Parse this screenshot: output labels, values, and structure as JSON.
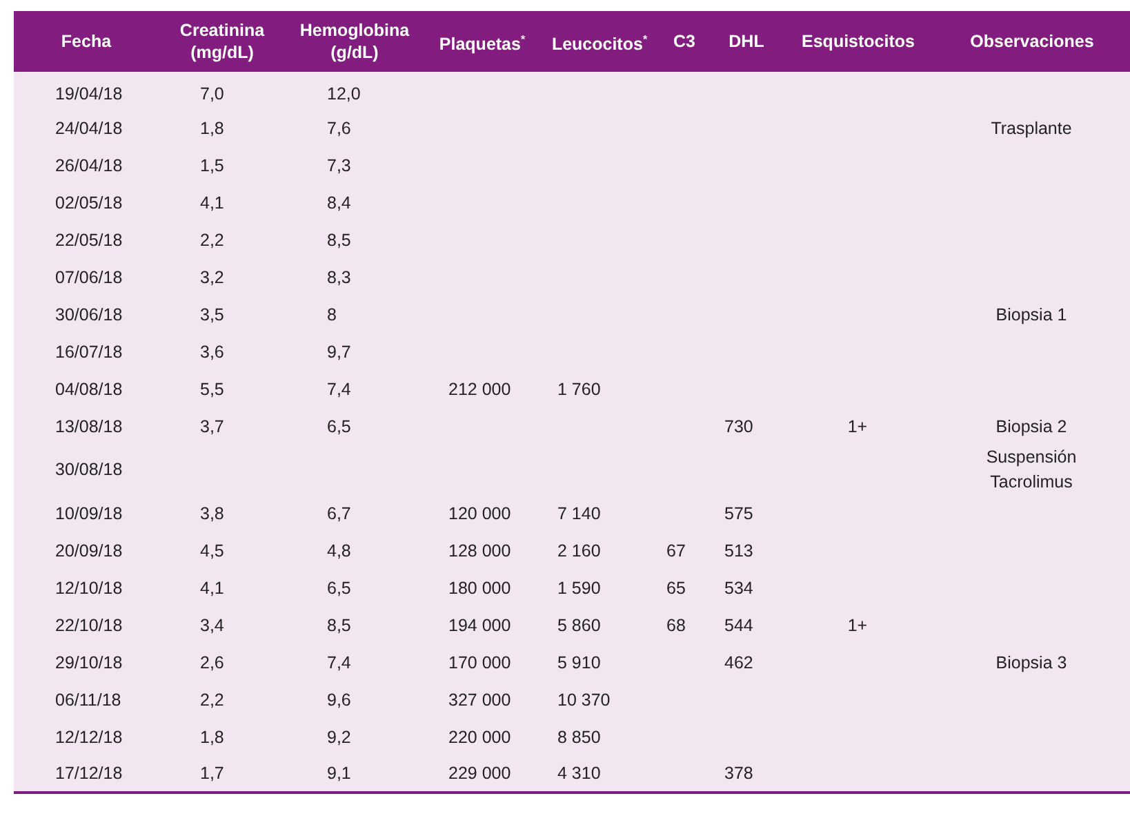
{
  "table": {
    "columns": [
      "Fecha",
      "Creatinina (mg/dL)",
      "Hemoglobina (g/dL)",
      "Plaquetas$^{*}$",
      "Leucocitos$^{*}$",
      "C3",
      "DHL",
      "Esquistocitos",
      "Observaciones"
    ],
    "rows": [
      [
        "19/04/18",
        "7,0",
        "12,0",
        null,
        null,
        null,
        null,
        null,
        null
      ],
      [
        "24/04/18",
        "1,8",
        "7,6",
        null,
        null,
        null,
        null,
        null,
        "Trasplante"
      ],
      [
        "26/04/18",
        "1,5",
        "7,3",
        null,
        null,
        null,
        null,
        null,
        null
      ],
      [
        "02/05/18",
        "4,1",
        "8,4",
        null,
        null,
        null,
        null,
        null,
        null
      ],
      [
        "22/05/18",
        "2,2",
        "8,5",
        null,
        null,
        null,
        null,
        null,
        null
      ],
      [
        "07/06/18",
        "3,2",
        "8,3",
        null,
        null,
        null,
        null,
        null,
        null
      ],
      [
        "30/06/18",
        "3,5",
        "8",
        null,
        null,
        null,
        null,
        null,
        "Biopsia 1"
      ],
      [
        "16/07/18",
        "3,6",
        "9,7",
        null,
        null,
        null,
        null,
        null,
        null
      ],
      [
        "04/08/18",
        "5,5",
        "7,4",
        "212 000",
        "1 760",
        null,
        null,
        null,
        null
      ],
      [
        "13/08/18",
        "3,7",
        "6,5",
        null,
        null,
        null,
        "730",
        "1+",
        "Biopsia 2"
      ],
      [
        "30/08/18",
        null,
        null,
        null,
        null,
        null,
        null,
        null,
        "Suspensión Tacrolimus"
      ],
      [
        "10/09/18",
        "3,8",
        "6,7",
        "120 000",
        "7 140",
        null,
        "575",
        null,
        null
      ],
      [
        "20/09/18",
        "4,5",
        "4,8",
        "128 000",
        "2 160",
        "67",
        "513",
        null,
        null
      ],
      [
        "12/10/18",
        "4,1",
        "6,5",
        "180 000",
        "1 590",
        "65",
        "534",
        null,
        null
      ],
      [
        "22/10/18",
        "3,4",
        "8,5",
        "194 000",
        "5 860",
        "68",
        "544",
        "1+",
        null
      ],
      [
        "29/10/18",
        "2,6",
        "7,4",
        "170 000",
        "5 910",
        null,
        "462",
        null,
        "Biopsia 3"
      ],
      [
        "06/11/18",
        "2,2",
        "9,6",
        "327 000",
        "10 370",
        null,
        null,
        null,
        null
      ],
      [
        "12/12/18",
        "1,8",
        "9,2",
        "220 000",
        "8 850",
        null,
        null,
        null,
        null
      ],
      [
        "17/12/18",
        "1,7",
        "9,1",
        "229 000",
        "4 310",
        null,
        "378",
        null,
        null
      ]
    ]
  }
}
